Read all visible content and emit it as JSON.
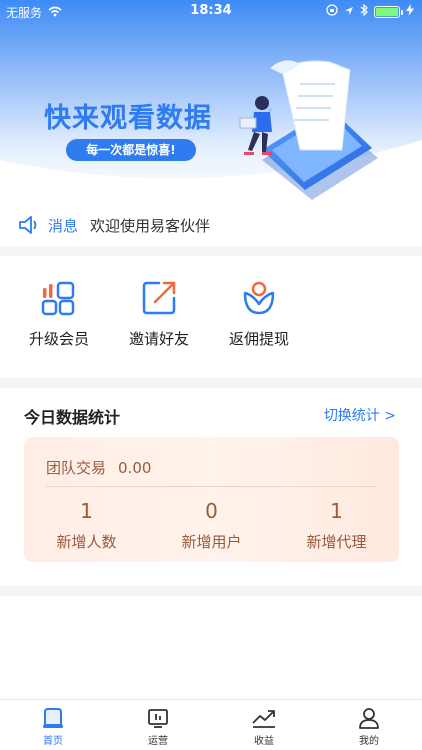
{
  "status_bar": {
    "carrier": "无服务",
    "time": "18:34"
  },
  "hero": {
    "title": "快来观看数据",
    "subtitle": "每一次都是惊喜!"
  },
  "notice": {
    "label": "消息",
    "text": "欢迎使用易客伙伴"
  },
  "actions": [
    {
      "label": "升级会员",
      "icon": "upgrade-member-icon"
    },
    {
      "label": "邀请好友",
      "icon": "invite-friend-icon"
    },
    {
      "label": "返佣提现",
      "icon": "commission-withdraw-icon"
    }
  ],
  "stats": {
    "title": "今日数据统计",
    "switch_label": "切换统计 >",
    "team_label": "团队交易",
    "team_value": "0.00",
    "metrics": [
      {
        "value": "1",
        "label": "新增人数"
      },
      {
        "value": "0",
        "label": "新增用户"
      },
      {
        "value": "1",
        "label": "新增代理"
      }
    ]
  },
  "tabbar": [
    {
      "label": "首页",
      "icon": "home-icon",
      "active": true
    },
    {
      "label": "运营",
      "icon": "operation-icon",
      "active": false
    },
    {
      "label": "收益",
      "icon": "earnings-icon",
      "active": false
    },
    {
      "label": "我的",
      "icon": "profile-icon",
      "active": false
    }
  ],
  "colors": {
    "accent": "#2F7BF0",
    "orange": "#F0693C",
    "card_text": "#9A5A3C"
  }
}
